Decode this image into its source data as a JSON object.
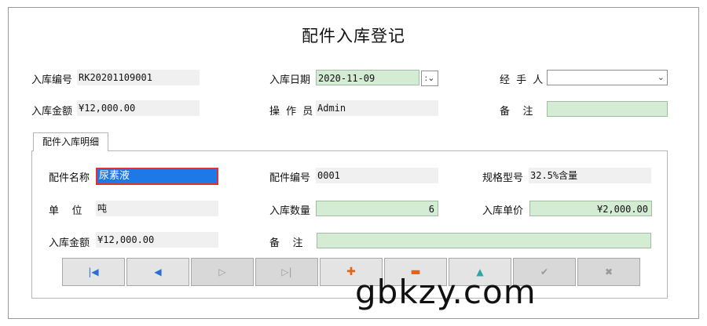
{
  "title": "配件入库登记",
  "header": {
    "receipt_no_label": "入库编号",
    "receipt_no": "RK20201109001",
    "date_label": "入库日期",
    "date": "2020-11-09",
    "handler_label": "经 手 人",
    "handler": "",
    "amount_label": "入库金额",
    "amount": "¥12,000.00",
    "operator_label": "操 作 员",
    "operator": "Admin",
    "remark_label": "备    注",
    "remark": ""
  },
  "detail": {
    "tab_label": "配件入库明细",
    "part_name_label": "配件名称",
    "part_name": "尿素液",
    "part_no_label": "配件编号",
    "part_no": "0001",
    "spec_label": "规格型号",
    "spec": "32.5%含量",
    "unit_label": "单    位",
    "unit": "吨",
    "qty_label": "入库数量",
    "qty": "6",
    "price_label": "入库单价",
    "price": "¥2,000.00",
    "amount_label": "入库金额",
    "amount": "¥12,000.00",
    "remark_label": "备    注",
    "remark": ""
  },
  "navigator": {
    "icons": [
      "first-icon",
      "prior-icon",
      "next-icon",
      "last-icon",
      "insert-icon",
      "delete-icon",
      "edit-icon",
      "post-icon",
      "cancel-icon"
    ]
  },
  "watermark": "gbkzy.com"
}
